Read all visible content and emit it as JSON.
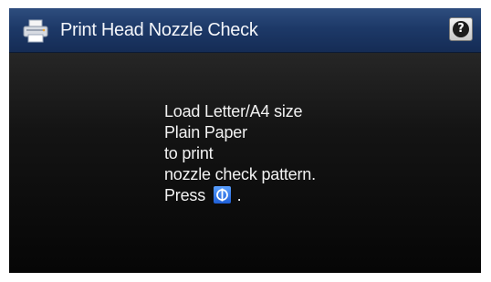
{
  "header": {
    "title": "Print Head Nozzle Check",
    "icon": "printer-icon",
    "help_icon": "help-icon",
    "help_label": "?"
  },
  "message": {
    "line1": "Load Letter/A4 size",
    "line2": "Plain Paper",
    "line3": "to print",
    "line4": "nozzle check pattern.",
    "line5_prefix": "Press",
    "line5_suffix": ".",
    "start_icon": "start-button-icon"
  },
  "colors": {
    "title_bar": "#1d3968",
    "background": "#0a0a0a",
    "text": "#f2f2f2",
    "start_icon": "#2f74e8"
  }
}
